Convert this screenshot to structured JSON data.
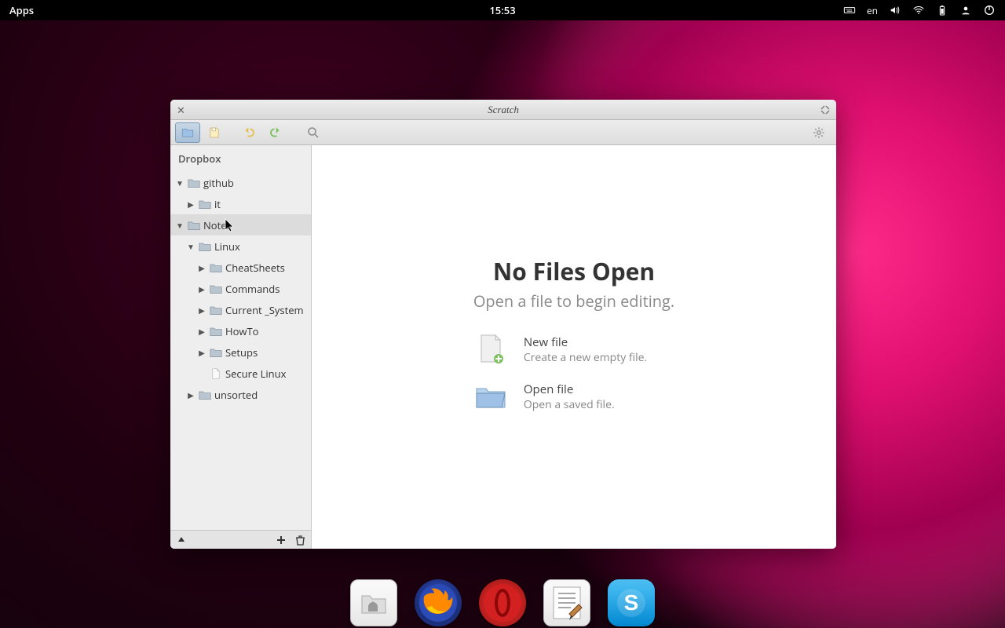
{
  "top_panel": {
    "apps": "Apps",
    "clock": "15:53",
    "lang": "en"
  },
  "dock": {
    "items": [
      "files",
      "firefox",
      "opera",
      "text-editor",
      "skype"
    ]
  },
  "window": {
    "title": "Scratch"
  },
  "sidebar": {
    "header": "Dropbox",
    "tree": [
      {
        "label": "github",
        "depth": 0,
        "expanded": true,
        "kind": "folder"
      },
      {
        "label": "it",
        "depth": 1,
        "expanded": false,
        "kind": "folder"
      },
      {
        "label": "Notes",
        "depth": 0,
        "expanded": true,
        "kind": "folder",
        "selected": true
      },
      {
        "label": "Linux",
        "depth": 1,
        "expanded": true,
        "kind": "folder"
      },
      {
        "label": "CheatSheets",
        "depth": 2,
        "expanded": false,
        "kind": "folder"
      },
      {
        "label": "Commands",
        "depth": 2,
        "expanded": false,
        "kind": "folder"
      },
      {
        "label": "Current _System",
        "depth": 2,
        "expanded": false,
        "kind": "folder"
      },
      {
        "label": "HowTo",
        "depth": 2,
        "expanded": false,
        "kind": "folder"
      },
      {
        "label": "Setups",
        "depth": 2,
        "expanded": false,
        "kind": "folder"
      },
      {
        "label": "Secure Linux",
        "depth": 2,
        "expanded": null,
        "kind": "file"
      },
      {
        "label": "unsorted",
        "depth": 1,
        "expanded": false,
        "kind": "folder"
      }
    ]
  },
  "content": {
    "empty_title": "No Files Open",
    "empty_sub": "Open a file to begin editing.",
    "new_file": {
      "title": "New file",
      "sub": "Create a new empty file."
    },
    "open_file": {
      "title": "Open file",
      "sub": "Open a saved file."
    }
  }
}
